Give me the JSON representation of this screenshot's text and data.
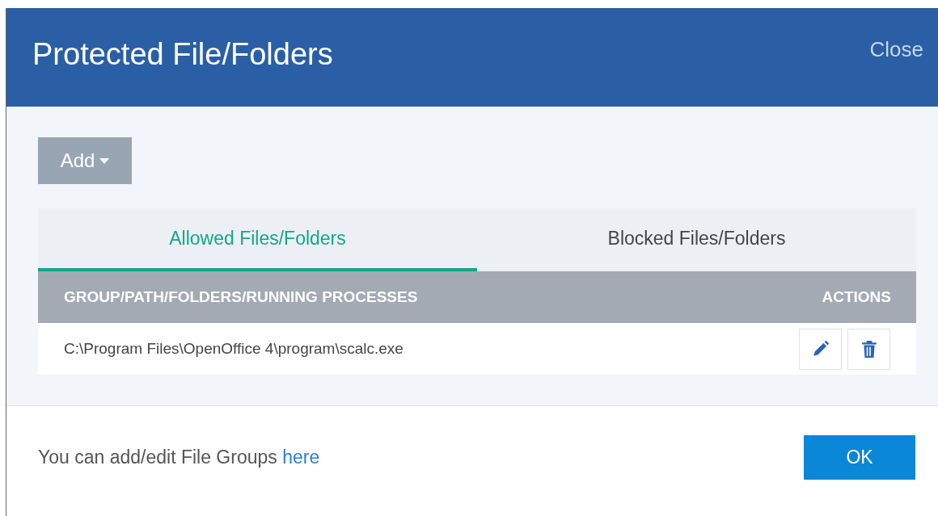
{
  "dialog": {
    "title": "Protected File/Folders",
    "close": "Close"
  },
  "add_button": {
    "label": "Add"
  },
  "tabs": [
    {
      "label": "Allowed Files/Folders",
      "selected": true
    },
    {
      "label": "Blocked Files/Folders",
      "selected": false
    }
  ],
  "table": {
    "columns": [
      "GROUP/PATH/FOLDERS/RUNNING PROCESSES",
      "ACTIONS"
    ],
    "rows": [
      {
        "path": "C:\\Program Files\\OpenOffice 4\\program\\scalc.exe"
      }
    ]
  },
  "footer": {
    "text": "You can add/edit File Groups",
    "link": "here",
    "ok": "OK"
  }
}
